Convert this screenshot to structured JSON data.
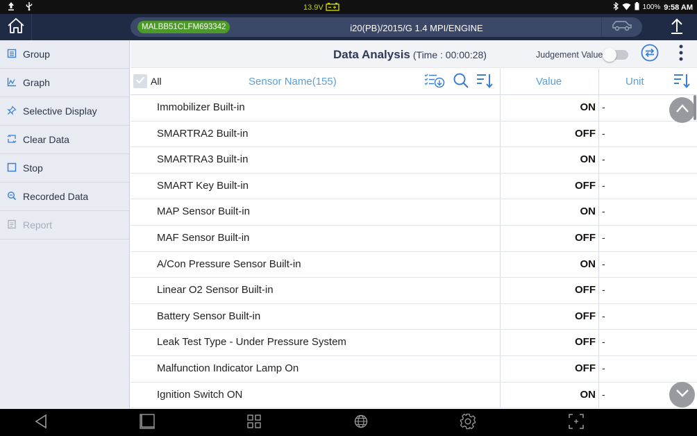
{
  "status_bar": {
    "voltage": "13.9V",
    "battery_percent": "100%",
    "time": "9:58 AM"
  },
  "header": {
    "vin": "MALBB51CLFM693342",
    "vehicle": "i20(PB)/2015/G 1.4 MPI/ENGINE"
  },
  "sidebar": {
    "items": [
      {
        "label": "Group",
        "icon": "group-icon",
        "enabled": true
      },
      {
        "label": "Graph",
        "icon": "graph-icon",
        "enabled": true
      },
      {
        "label": "Selective Display",
        "icon": "pin-icon",
        "enabled": true
      },
      {
        "label": "Clear Data",
        "icon": "clear-icon",
        "enabled": true
      },
      {
        "label": "Stop",
        "icon": "stop-icon",
        "enabled": true
      },
      {
        "label": "Recorded Data",
        "icon": "recorded-search-icon",
        "enabled": true
      },
      {
        "label": "Report",
        "icon": "report-icon",
        "enabled": false
      }
    ]
  },
  "main": {
    "title": "Data Analysis",
    "time": "(Time : 00:00:28)",
    "judgement_label": "Judgement Value",
    "judgement_enabled": false
  },
  "table": {
    "all_label": "All",
    "columns": {
      "sensor": "Sensor Name(155)",
      "value": "Value",
      "unit": "Unit"
    },
    "rows": [
      {
        "name": "Immobilizer Built-in",
        "value": "ON",
        "unit": "-"
      },
      {
        "name": "SMARTRA2 Built-in",
        "value": "OFF",
        "unit": "-"
      },
      {
        "name": "SMARTRA3 Built-in",
        "value": "ON",
        "unit": "-"
      },
      {
        "name": "SMART Key Built-in",
        "value": "OFF",
        "unit": "-"
      },
      {
        "name": "MAP Sensor Built-in",
        "value": "ON",
        "unit": "-"
      },
      {
        "name": "MAF Sensor Built-in",
        "value": "OFF",
        "unit": "-"
      },
      {
        "name": "A/Con Pressure Sensor Built-in",
        "value": "ON",
        "unit": "-"
      },
      {
        "name": "Linear O2 Sensor Built-in",
        "value": "OFF",
        "unit": "-"
      },
      {
        "name": "Battery Sensor Built-in",
        "value": "OFF",
        "unit": "-"
      },
      {
        "name": "Leak Test Type - Under Pressure System",
        "value": "OFF",
        "unit": "-"
      },
      {
        "name": "Malfunction Indicator Lamp On",
        "value": "OFF",
        "unit": "-"
      },
      {
        "name": "Ignition Switch ON",
        "value": "ON",
        "unit": "-"
      }
    ]
  },
  "colors": {
    "header_bg": "#1f2a44",
    "vin_badge": "#4c9a2a",
    "column_header": "#5a9fd6",
    "accent_icon": "#3a7fd0"
  }
}
